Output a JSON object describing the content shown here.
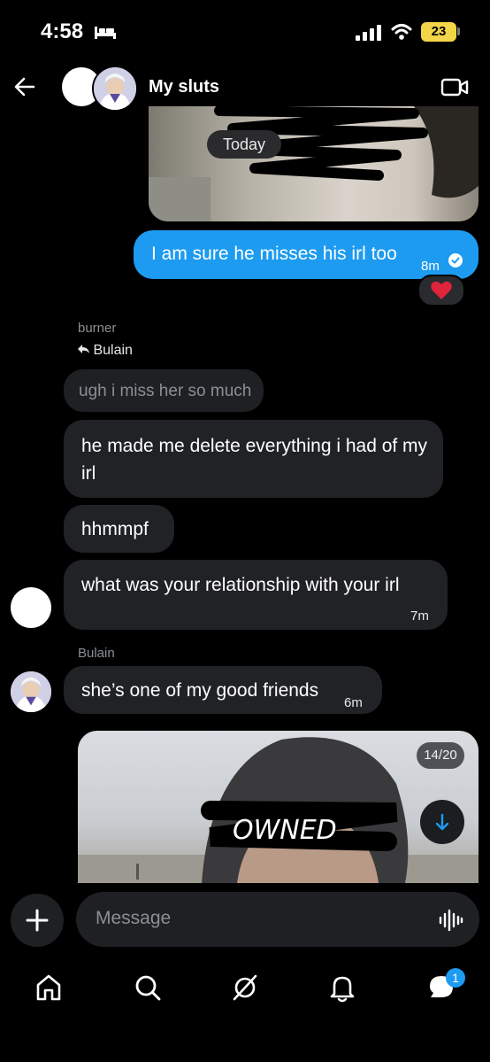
{
  "status_bar": {
    "time": "4:58",
    "battery": "23"
  },
  "header": {
    "title": "My sluts"
  },
  "media_top": {
    "date_label": "Today"
  },
  "messages": [
    {
      "text": "I am sure he misses his irl too",
      "time": "8m",
      "reaction": "❤️"
    },
    {
      "sender": "burner",
      "reply_to": "Bulain",
      "text": "ugh i miss her so much"
    },
    {
      "text": "he made me delete everything i had of my irl"
    },
    {
      "text": "hhmmpf"
    },
    {
      "text": "what was your relationship with your irl",
      "time": "7m"
    },
    {
      "sender": "Bulain",
      "text": "she’s one of my good friends",
      "time": "6m"
    }
  ],
  "media_bottom": {
    "counter": "14/20",
    "scribble_text": "OWNED"
  },
  "composer": {
    "placeholder": "Message"
  },
  "nav": {
    "messages_badge": "1"
  },
  "colors": {
    "accent": "#1d9bf0",
    "bubble_in": "#202225",
    "background": "#000000"
  }
}
